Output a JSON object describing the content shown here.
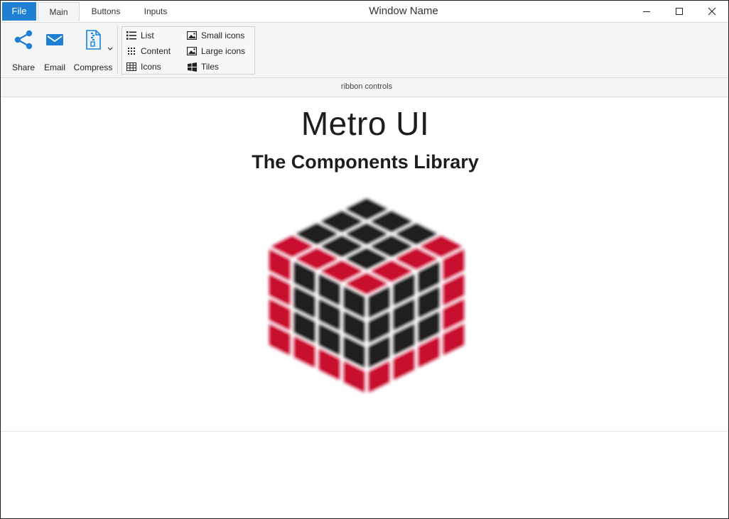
{
  "window": {
    "title": "Window Name"
  },
  "tabs": {
    "file": "File",
    "items": [
      "Main",
      "Buttons",
      "Inputs"
    ]
  },
  "ribbon": {
    "buttons": {
      "share": "Share",
      "email": "Email",
      "compress": "Compress"
    },
    "view_options": {
      "list": "List",
      "content": "Content",
      "icons": "Icons",
      "small_icons": "Small icons",
      "large_icons": "Large icons",
      "tiles": "Tiles"
    },
    "group_title": "ribbon controls"
  },
  "content": {
    "heading": "Metro UI",
    "subheading": "The Components Library"
  },
  "colors": {
    "accent": "#1e7fd3",
    "logo_red": "#c8102e",
    "logo_dark": "#1f1f1f"
  }
}
